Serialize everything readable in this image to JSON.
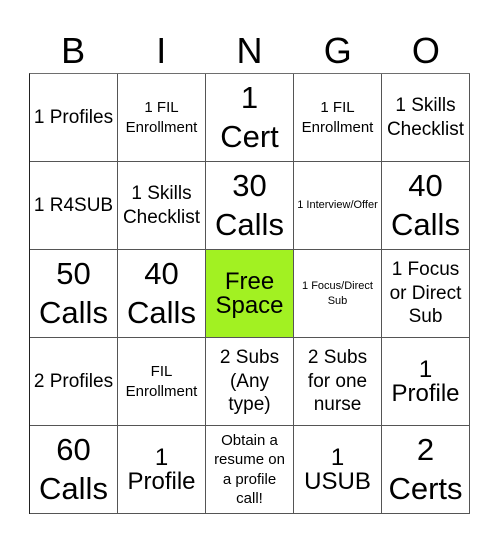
{
  "header": {
    "letters": [
      "B",
      "I",
      "N",
      "G",
      "O"
    ]
  },
  "board": {
    "free_space_color": "#a2f122",
    "rows": [
      [
        {
          "text": "1 Profiles",
          "size": "md"
        },
        {
          "text": "1 FIL Enrollment",
          "size": "sm"
        },
        {
          "text": "1 Cert",
          "size": "xl"
        },
        {
          "text": "1 FIL Enrollment",
          "size": "sm"
        },
        {
          "text": "1 Skills Checklist",
          "size": "md"
        }
      ],
      [
        {
          "text": "1 R4SUB",
          "size": "md"
        },
        {
          "text": "1 Skills Checklist",
          "size": "md"
        },
        {
          "text": "30 Calls",
          "size": "xl"
        },
        {
          "text": "1 Interview/Offer",
          "size": "xs"
        },
        {
          "text": "40 Calls",
          "size": "xl"
        }
      ],
      [
        {
          "text": "50 Calls",
          "size": "xl"
        },
        {
          "text": "40 Calls",
          "size": "xl"
        },
        {
          "text": "Free Space",
          "size": "lg",
          "free": true
        },
        {
          "text": "1 Focus/Direct Sub",
          "size": "xs"
        },
        {
          "text": "1 Focus or Direct Sub",
          "size": "md"
        }
      ],
      [
        {
          "text": "2 Profiles",
          "size": "md"
        },
        {
          "text": "FIL Enrollment",
          "size": "sm"
        },
        {
          "text": "2 Subs (Any type)",
          "size": "md"
        },
        {
          "text": "2 Subs for one nurse",
          "size": "md"
        },
        {
          "text": "1 Profile",
          "size": "lg"
        }
      ],
      [
        {
          "text": "60 Calls",
          "size": "xl"
        },
        {
          "text": "1 Profile",
          "size": "lg"
        },
        {
          "text": "Obtain a resume on a profile call!",
          "size": "sm"
        },
        {
          "text": "1 USUB",
          "size": "lg"
        },
        {
          "text": "2 Certs",
          "size": "xl"
        }
      ]
    ]
  }
}
